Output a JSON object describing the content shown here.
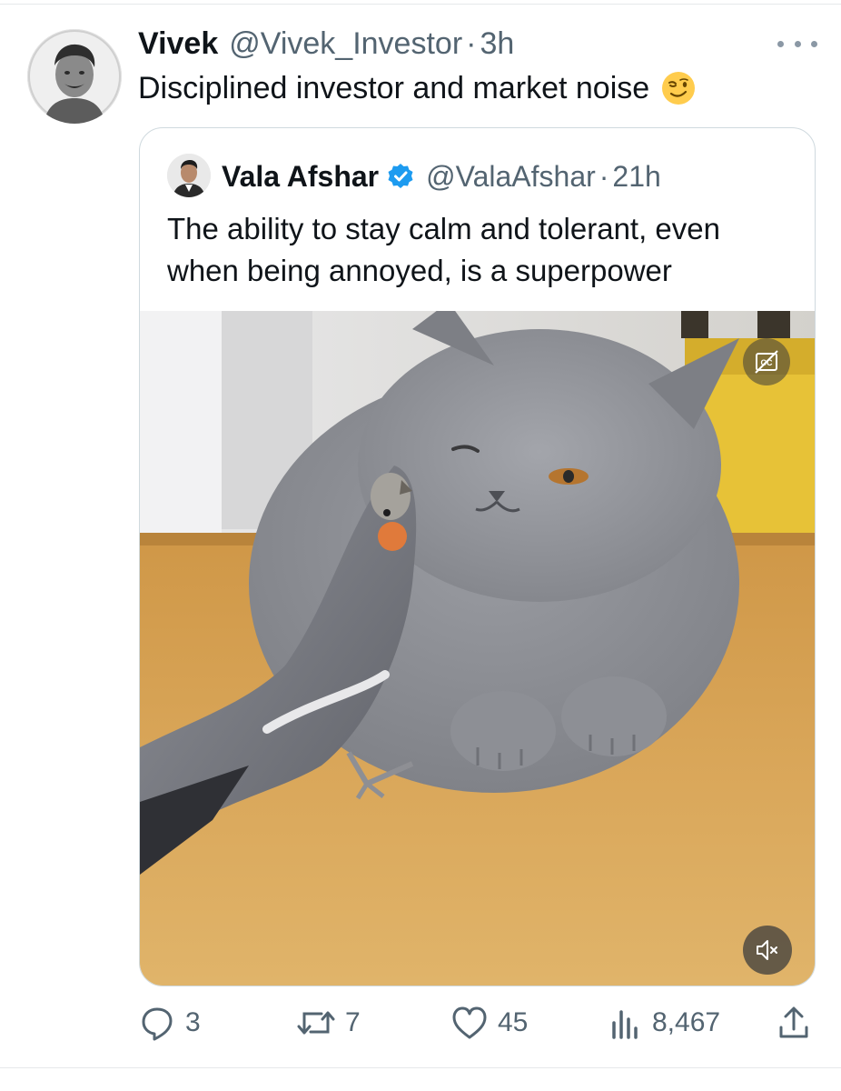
{
  "tweet": {
    "author_name": "Vivek",
    "author_handle": "@Vivek_Investor",
    "separator": "·",
    "time": "3h",
    "text": "Disciplined investor and market noise",
    "emoji_icon": "winking-face-icon"
  },
  "quoted_tweet": {
    "author_name": "Vala Afshar",
    "author_handle": "@ValaAfshar",
    "separator": "·",
    "time": "21h",
    "verified": true,
    "text": "The ability to stay calm and tolerant, even when being annoyed, is a superpower",
    "media": {
      "type": "video",
      "captions_icon": "closed-captions-icon",
      "mute_icon": "speaker-muted-icon"
    }
  },
  "actions": {
    "replies": "3",
    "reposts": "7",
    "likes": "45",
    "views": "8,467"
  },
  "colors": {
    "text_primary": "#0f1419",
    "text_secondary": "#536471",
    "verified_blue": "#1d9bf0",
    "border": "#cfd9de"
  }
}
